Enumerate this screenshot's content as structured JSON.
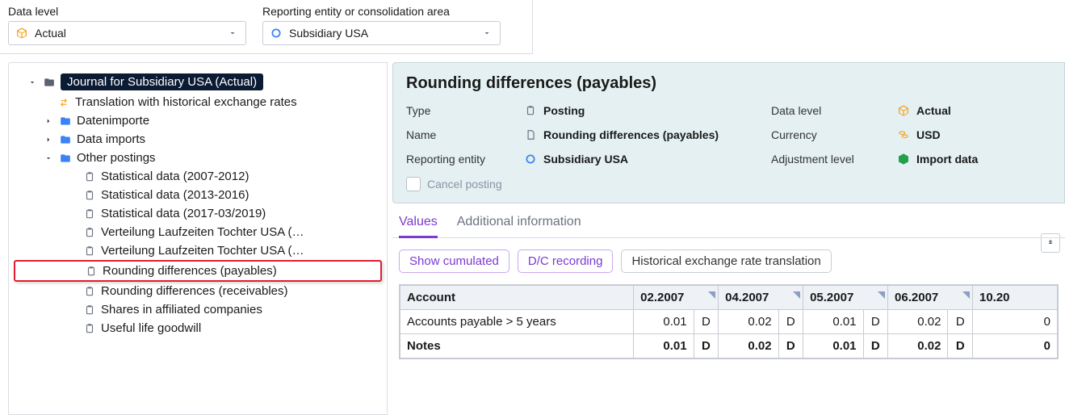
{
  "filters": {
    "data_level_label": "Data level",
    "data_level_value": "Actual",
    "entity_label": "Reporting entity or consolidation area",
    "entity_value": "Subsidiary USA"
  },
  "tree": {
    "root": "Journal for Subsidiary USA (Actual)",
    "n_translation": "Translation with historical exchange rates",
    "n_datenimporte": "Datenimporte",
    "n_dataimports": "Data imports",
    "n_other": "Other postings",
    "leaves": {
      "s0712": "Statistical data (2007-2012)",
      "s1316": "Statistical data (2013-2016)",
      "s1719": "Statistical data (2017-03/2019)",
      "v1": "Verteilung Laufzeiten Tochter USA (…",
      "v2": "Verteilung Laufzeiten Tochter USA (…",
      "rp": "Rounding differences (payables)",
      "rr": "Rounding differences (receivables)",
      "sh": "Shares in affiliated companies",
      "ul": "Useful life goodwill"
    }
  },
  "detail": {
    "title": "Rounding differences (payables)",
    "labels": {
      "type": "Type",
      "name": "Name",
      "entity": "Reporting entity",
      "data_level": "Data level",
      "currency": "Currency",
      "adj": "Adjustment level",
      "cancel": "Cancel posting"
    },
    "values": {
      "type": "Posting",
      "name": "Rounding differences (payables)",
      "entity": "Subsidiary USA",
      "data_level": "Actual",
      "currency": "USD",
      "adj": "Import data"
    }
  },
  "tabs": {
    "values": "Values",
    "addl": "Additional information"
  },
  "buttons": {
    "cumulated": "Show cumulated",
    "dc": "D/C recording",
    "hist": "Historical exchange rate translation"
  },
  "table": {
    "headers": {
      "account": "Account",
      "p1": "02.2007",
      "p2": "04.2007",
      "p3": "05.2007",
      "p4": "06.2007",
      "p5": "10.20"
    },
    "rows": [
      {
        "acct": "Accounts payable > 5 years",
        "v": [
          "0.01",
          "D",
          "0.02",
          "D",
          "0.01",
          "D",
          "0.02",
          "D",
          "0"
        ]
      }
    ],
    "totals": {
      "acct": "Notes",
      "v": [
        "0.01",
        "D",
        "0.02",
        "D",
        "0.01",
        "D",
        "0.02",
        "D",
        "0"
      ]
    }
  }
}
